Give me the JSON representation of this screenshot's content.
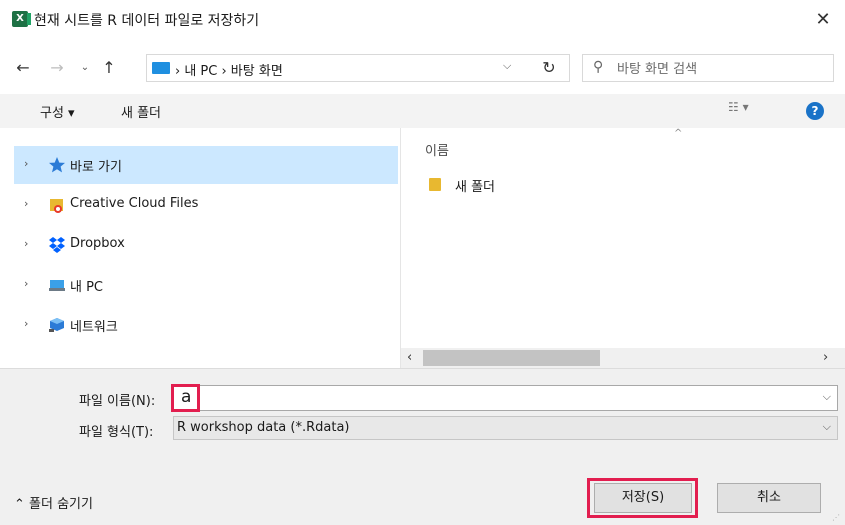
{
  "window": {
    "title": "현재 시트를 R 데이터 파일로 저장하기",
    "app_icon": "X",
    "close_glyph": "✕"
  },
  "nav": {
    "back_glyph": "←",
    "forward_glyph": "→",
    "recent_glyph": "⌄",
    "up_glyph": "↑",
    "address_path": "› 내 PC › 바탕 화면",
    "address_chevron": "⌵",
    "refresh_glyph": "↻",
    "search_placeholder": "바탕 화면 검색",
    "search_glyph": "⚲"
  },
  "commands": {
    "organize": "구성 ▾",
    "new_folder": "새 폴더",
    "view": "☷ ▾",
    "help": "?"
  },
  "nav_pane": {
    "items": [
      {
        "label": "바로 가기",
        "icon": "star-icon",
        "selected": true
      },
      {
        "label": "Creative Cloud Files",
        "icon": "creative-cloud-folder-icon",
        "selected": false
      },
      {
        "label": "Dropbox",
        "icon": "dropbox-icon",
        "selected": false
      },
      {
        "label": "내 PC",
        "icon": "pc-icon",
        "selected": false
      },
      {
        "label": "네트워크",
        "icon": "network-icon",
        "selected": false
      }
    ],
    "chevron": "›"
  },
  "content": {
    "column_name": "이름",
    "sort_glyph": "^",
    "items": [
      {
        "label": "새 폴더",
        "icon": "folder-icon"
      }
    ]
  },
  "scrollbar": {
    "left_glyph": "‹",
    "right_glyph": "›"
  },
  "form": {
    "filename_label": "파일 이름(N):",
    "filename_value": "a",
    "filetype_label": "파일 형식(T):",
    "filetype_value": "R workshop data (*.Rdata)",
    "chevron": "⌵"
  },
  "footer": {
    "hide_folders": "⌃ 폴더 숨기기",
    "save": "저장(S)",
    "cancel": "취소"
  },
  "colors": {
    "highlight": "#e21e4f",
    "selected": "#cce8ff",
    "accent": "#1a73c8"
  }
}
